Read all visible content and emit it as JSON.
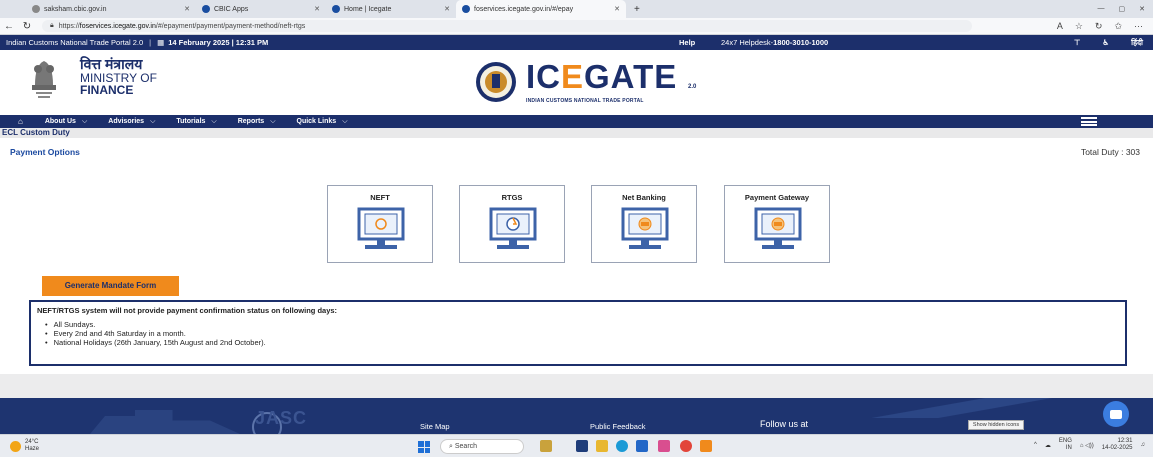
{
  "browser": {
    "tabs": [
      {
        "title": "saksham.cbic.gov.in"
      },
      {
        "title": "CBIC Apps"
      },
      {
        "title": "Home | Icegate"
      },
      {
        "title": "foservices.icegate.gov.in/#/epay"
      }
    ],
    "url_prefix": "https://",
    "url_host": "foservices.icegate.gov.in",
    "url_path": "/#/epayment/payment/payment-method/neft-rtgs"
  },
  "topbar": {
    "portal": "Indian Customs National Trade Portal 2.0",
    "date": "14 February 2025 | 12:31 PM",
    "help": "Help",
    "helpdesk_prefix": "24x7 Helpdesk-",
    "helpdesk_number": "1800-3010-1000",
    "hindi": "हिंदी"
  },
  "header": {
    "ministry_hi": "वित्त मंत्रालय",
    "ministry_en1": "MINISTRY OF",
    "ministry_en2": "FINANCE",
    "logo_a": "IC",
    "logo_b": "E",
    "logo_c": "GATE",
    "logo_ver": "2.0",
    "logo_sub": "INDIAN CUSTOMS NATIONAL TRADE PORTAL"
  },
  "nav": {
    "items": [
      "About Us",
      "Advisories",
      "Tutorials",
      "Reports",
      "Quick Links"
    ]
  },
  "breadcrumb": "ECL Custom Duty",
  "payment": {
    "title": "Payment Options",
    "total": "Total Duty : 303",
    "options": [
      {
        "label": "NEFT",
        "icon": "neft-icon"
      },
      {
        "label": "RTGS",
        "icon": "rtgs-icon"
      },
      {
        "label": "Net Banking",
        "icon": "net-banking-icon"
      },
      {
        "label": "Payment Gateway",
        "icon": "payment-gateway-icon"
      }
    ],
    "mandate_button": "Generate Mandate Form"
  },
  "notice": {
    "heading": "NEFT/RTGS system will not provide payment confirmation status on following days:",
    "items": [
      "All Sundays.",
      "Every 2nd and 4th Saturday in a month.",
      "National Holidays (26th January, 15th August and 2nd October)."
    ]
  },
  "footer": {
    "jasc": "JASC",
    "site_map": "Site Map",
    "public_feedback": "Public Feedback",
    "follow_us": "Follow us at",
    "hidden_icons": "Show hidden icons"
  },
  "taskbar": {
    "temp": "24°C",
    "weather": "Haze",
    "search": "Search",
    "lang1": "ENG",
    "lang2": "IN",
    "time": "12:31",
    "date": "14-02-2025"
  },
  "colors": {
    "navy": "#1c2f6b",
    "orange": "#f08a1c",
    "link_blue": "#1c4aa0"
  }
}
